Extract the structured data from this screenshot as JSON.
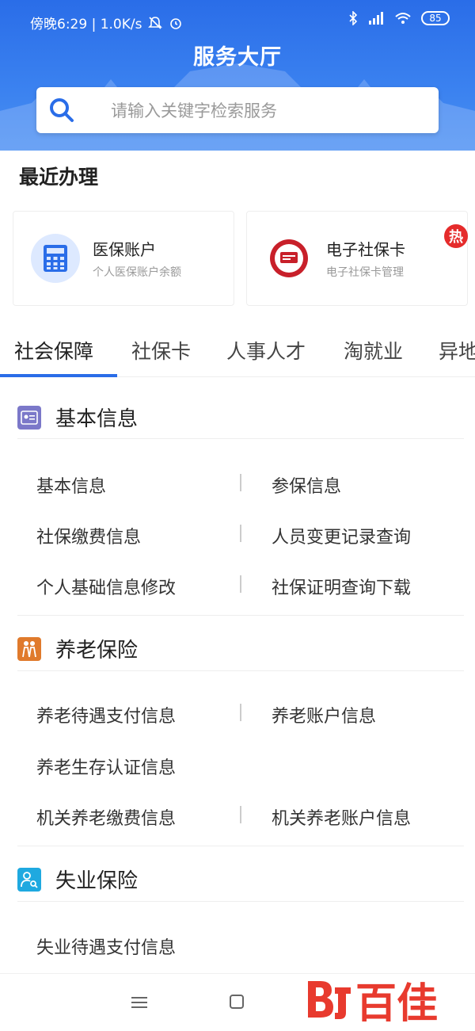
{
  "status": {
    "time": "傍晚6:29 | 1.0K/s",
    "battery": "85"
  },
  "header": {
    "title": "服务大厅",
    "search_placeholder": "请输入关键字检索服务"
  },
  "recent": {
    "title": "最近办理",
    "cards": [
      {
        "name": "医保账户",
        "sub": "个人医保账户余额"
      },
      {
        "name": "电子社保卡",
        "sub": "电子社保卡管理",
        "badge": "热"
      }
    ]
  },
  "tabs": [
    "社会保障",
    "社保卡",
    "人事人才",
    "淘就业",
    "异地"
  ],
  "categories": [
    {
      "title": "基本信息",
      "items": [
        "基本信息",
        "参保信息",
        "社保缴费信息",
        "人员变更记录查询",
        "个人基础信息修改",
        "社保证明查询下载"
      ]
    },
    {
      "title": "养老保险",
      "items": [
        "养老待遇支付信息",
        "养老账户信息",
        "养老生存认证信息",
        "机关养老缴费信息",
        "机关养老账户信息"
      ]
    },
    {
      "title": "失业保险",
      "items": [
        "失业待遇支付信息"
      ]
    }
  ],
  "watermark": "百佳",
  "colors": {
    "brand_blue": "#2a6de8",
    "hot_red": "#e52b2b",
    "cat_purple": "#7b78c9",
    "cat_orange": "#e07a2c",
    "cat_cyan": "#1fa9e0"
  }
}
